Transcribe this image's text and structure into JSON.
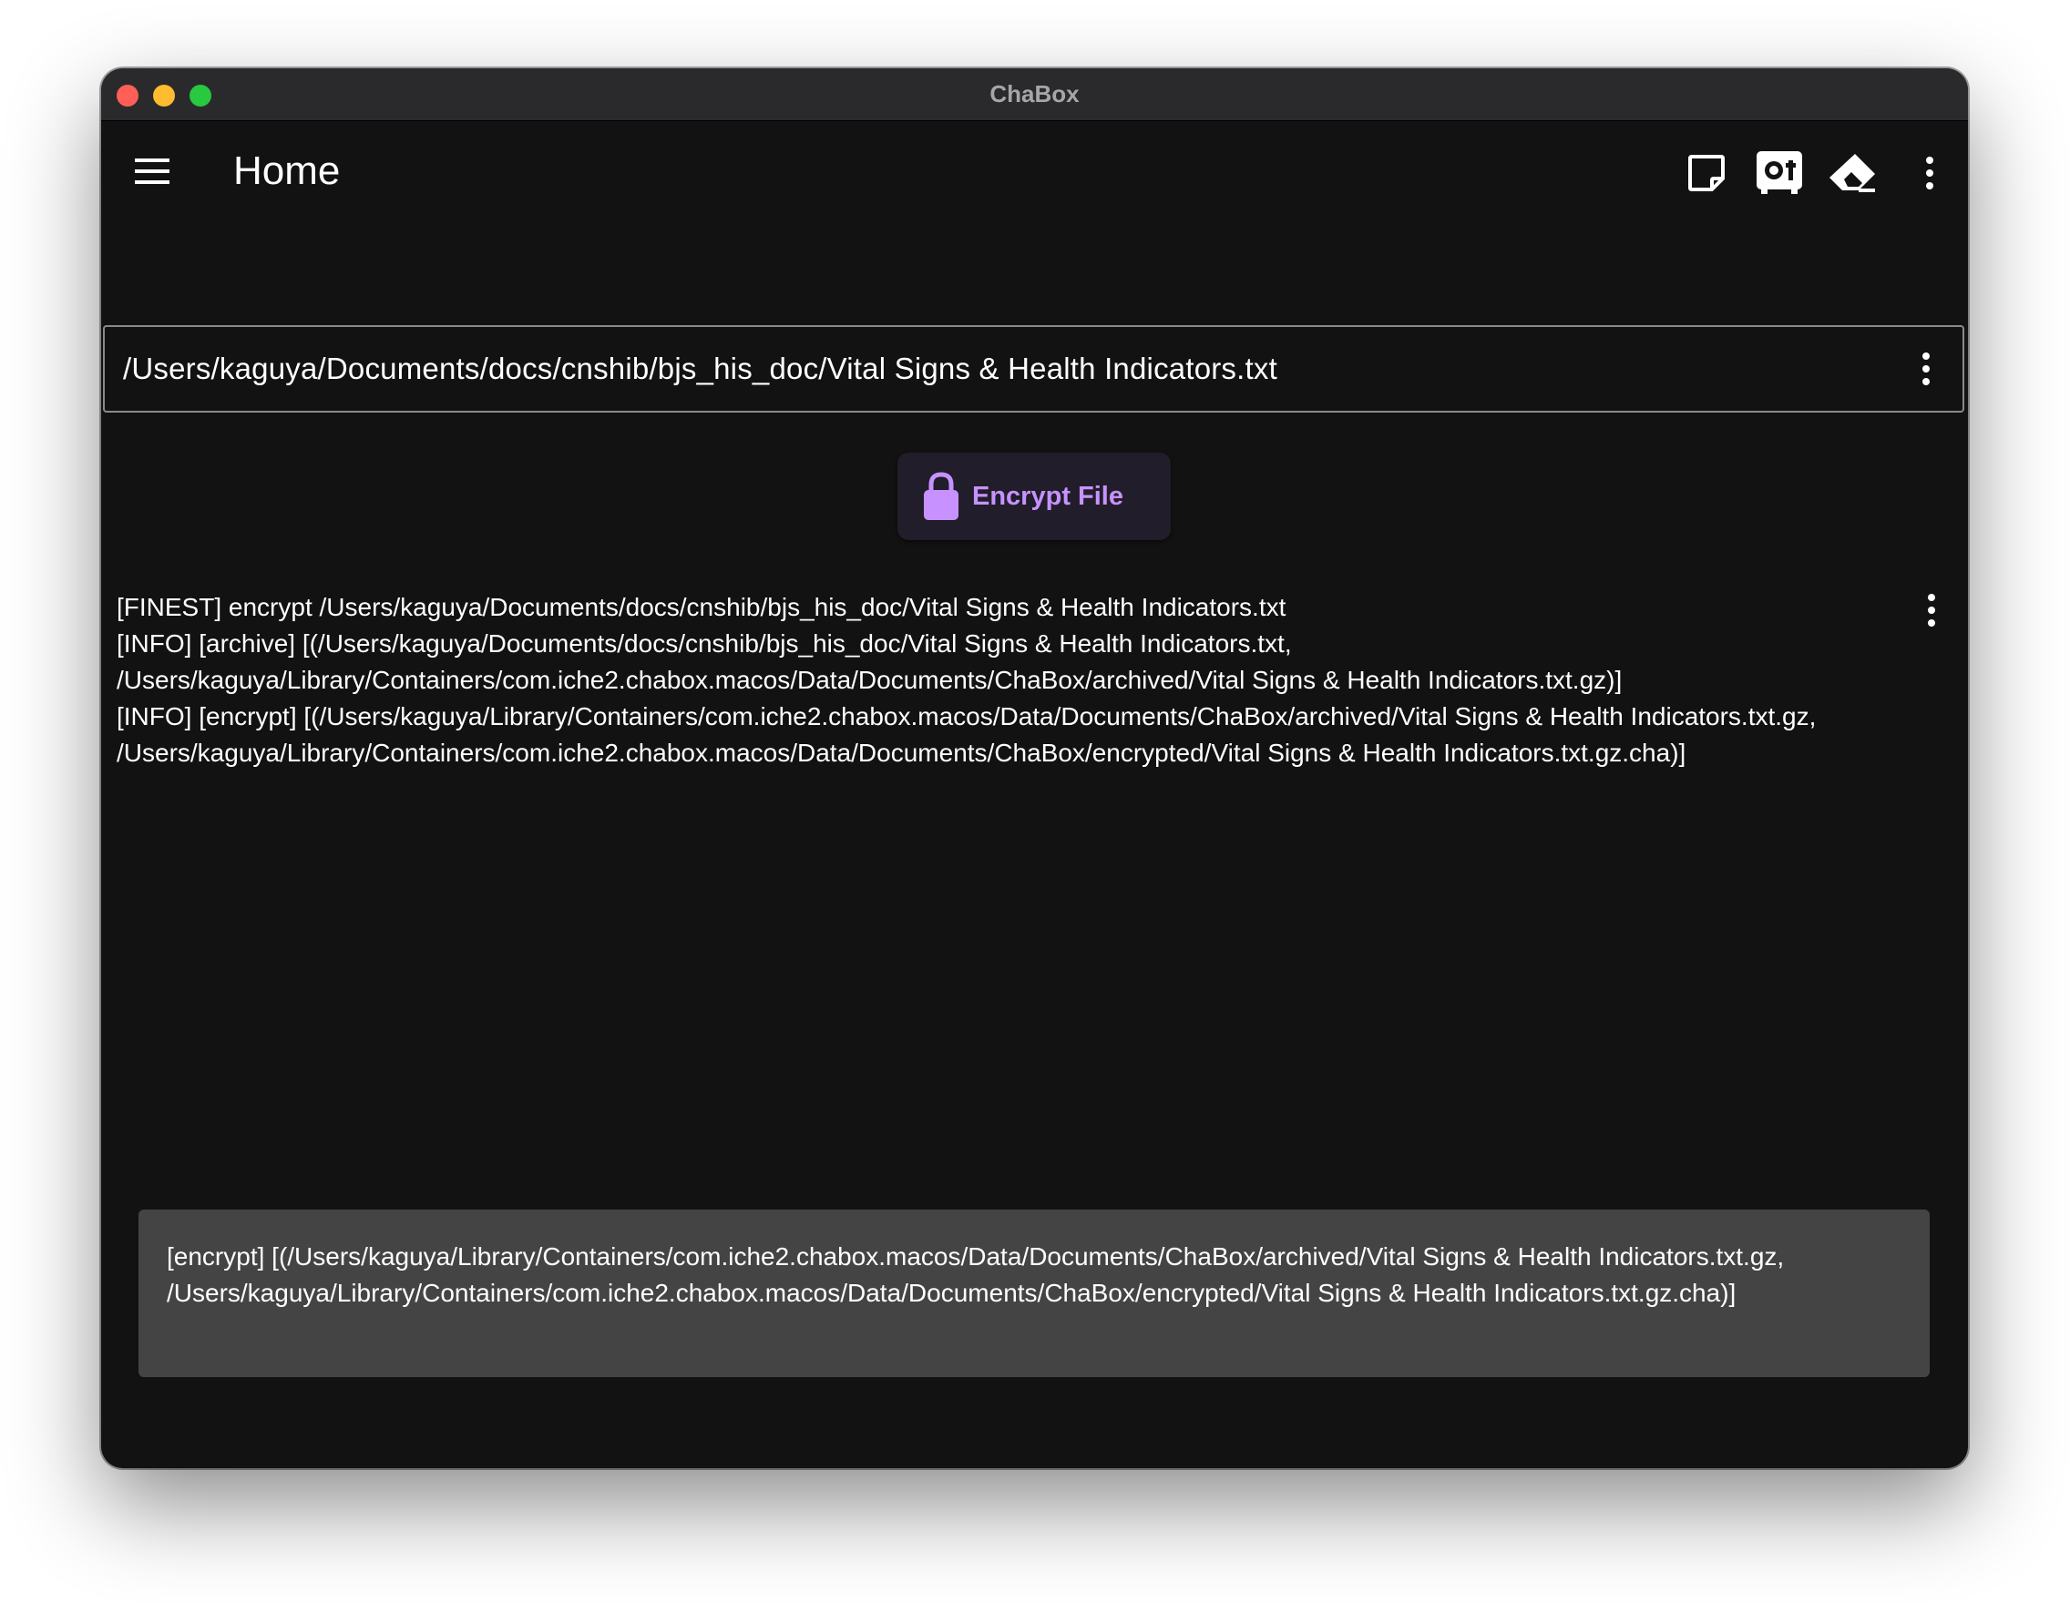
{
  "window": {
    "title": "ChaBox"
  },
  "appbar": {
    "title": "Home",
    "icons": [
      "menu-icon",
      "sticky-note-icon",
      "safe-icon",
      "eraser-icon",
      "more-vert-icon"
    ]
  },
  "file_field": {
    "path": "/Users/kaguya/Documents/docs/cnshib/bjs_his_doc/Vital Signs & Health Indicators.txt"
  },
  "encrypt_button": {
    "label": "Encrypt File",
    "icon": "lock-icon",
    "accent_color": "#c792ff"
  },
  "log": {
    "lines": [
      "[FINEST] encrypt /Users/kaguya/Documents/docs/cnshib/bjs_his_doc/Vital Signs & Health Indicators.txt",
      "[INFO] [archive] [(/Users/kaguya/Documents/docs/cnshib/bjs_his_doc/Vital Signs & Health Indicators.txt, /Users/kaguya/Library/Containers/com.iche2.chabox.macos/Data/Documents/ChaBox/archived/Vital Signs & Health Indicators.txt.gz)]",
      "[INFO] [encrypt] [(/Users/kaguya/Library/Containers/com.iche2.chabox.macos/Data/Documents/ChaBox/archived/Vital Signs & Health Indicators.txt.gz, /Users/kaguya/Library/Containers/com.iche2.chabox.macos/Data/Documents/ChaBox/encrypted/Vital Signs & Health Indicators.txt.gz.cha)]"
    ]
  },
  "snackbar": {
    "message": "[encrypt] [(/Users/kaguya/Library/Containers/com.iche2.chabox.macos/Data/Documents/ChaBox/archived/Vital Signs & Health Indicators.txt.gz, /Users/kaguya/Library/Containers/com.iche2.chabox.macos/Data/Documents/ChaBox/encrypted/Vital Signs & Health Indicators.txt.gz.cha)]"
  }
}
